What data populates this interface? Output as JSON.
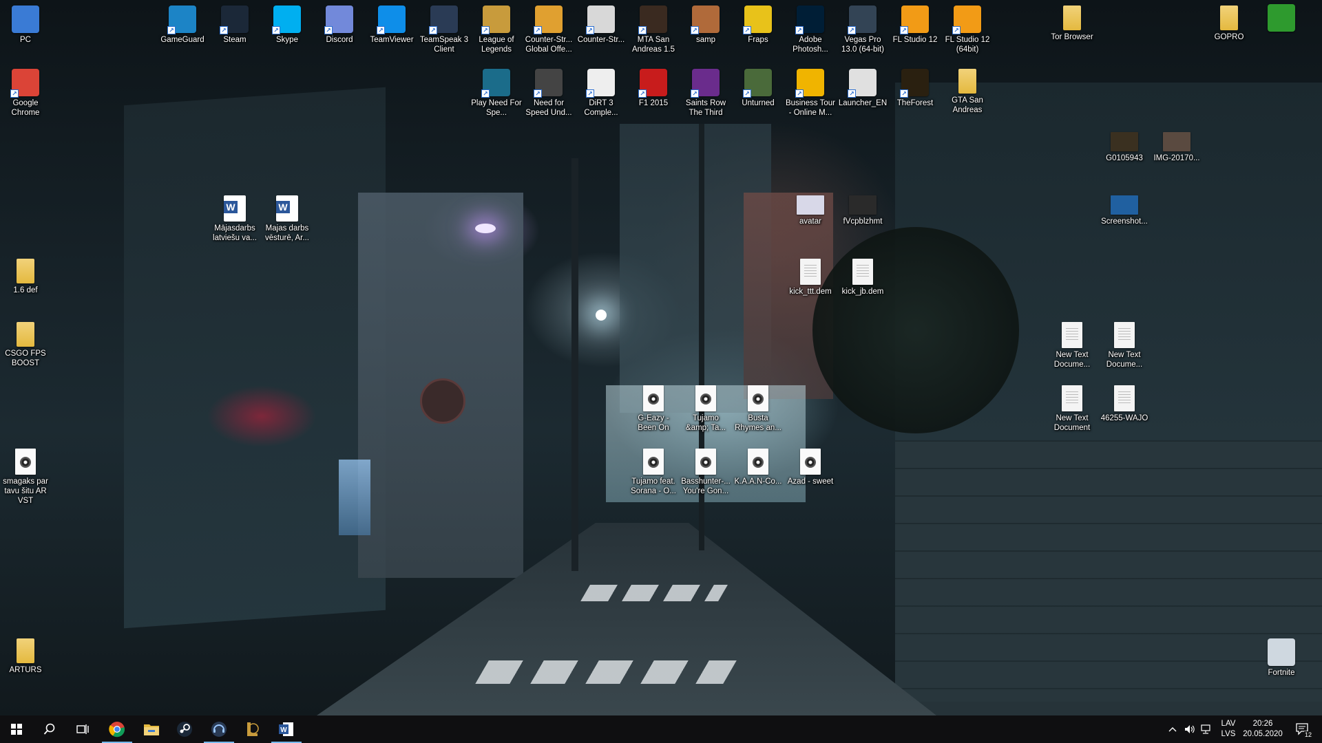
{
  "desktop_icons": [
    {
      "id": "pc",
      "label": "PC",
      "kind": "app",
      "color": "#3a7bd5",
      "glyph": "monitor-icon",
      "shortcut": false
    },
    {
      "id": "chrome",
      "label": "Google Chrome",
      "kind": "app",
      "color": "#db4437",
      "glyph": "chrome-icon",
      "shortcut": true
    },
    {
      "id": "gameguard",
      "label": "GameGuard",
      "kind": "app",
      "color": "#1c84c6",
      "glyph": "gameguard-icon",
      "shortcut": true
    },
    {
      "id": "steam",
      "label": "Steam",
      "kind": "app",
      "color": "#1b2838",
      "glyph": "steam-icon",
      "shortcut": true
    },
    {
      "id": "skype",
      "label": "Skype",
      "kind": "app",
      "color": "#00aff0",
      "glyph": "skype-icon",
      "shortcut": true
    },
    {
      "id": "discord",
      "label": "Discord",
      "kind": "app",
      "color": "#7289da",
      "glyph": "discord-icon",
      "shortcut": true
    },
    {
      "id": "teamviewer",
      "label": "TeamViewer",
      "kind": "app",
      "color": "#0e8ee9",
      "glyph": "teamviewer-icon",
      "shortcut": true
    },
    {
      "id": "teamspeak",
      "label": "TeamSpeak 3 Client",
      "kind": "app",
      "color": "#2a3b55",
      "glyph": "teamspeak-icon",
      "shortcut": true
    },
    {
      "id": "lol",
      "label": "League of Legends",
      "kind": "app",
      "color": "#c89b3c",
      "glyph": "league-icon",
      "shortcut": true
    },
    {
      "id": "csgo",
      "label": "Counter-Str... Global Offe...",
      "kind": "app",
      "color": "#e0a030",
      "glyph": "csgo-icon",
      "shortcut": true
    },
    {
      "id": "cs",
      "label": "Counter-Str...",
      "kind": "app",
      "color": "#d8d8d8",
      "glyph": "counter-strike-icon",
      "shortcut": true
    },
    {
      "id": "mta",
      "label": "MTA San Andreas 1.5",
      "kind": "app",
      "color": "#3a2a20",
      "glyph": "mta-icon",
      "shortcut": true
    },
    {
      "id": "samp",
      "label": "samp",
      "kind": "app",
      "color": "#b06a3a",
      "glyph": "samp-icon",
      "shortcut": true
    },
    {
      "id": "fraps",
      "label": "Fraps",
      "kind": "app",
      "color": "#e8c21a",
      "glyph": "fraps-icon",
      "shortcut": true
    },
    {
      "id": "photoshop",
      "label": "Adobe Photosh...",
      "kind": "app",
      "color": "#001e36",
      "glyph": "photoshop-icon",
      "shortcut": true
    },
    {
      "id": "vegas",
      "label": "Vegas Pro 13.0 (64-bit)",
      "kind": "app",
      "color": "#334455",
      "glyph": "vegas-icon",
      "shortcut": true
    },
    {
      "id": "fl12",
      "label": "FL Studio 12",
      "kind": "app",
      "color": "#f29b16",
      "glyph": "fl-studio-icon",
      "shortcut": true
    },
    {
      "id": "fl12x64",
      "label": "FL Studio 12 (64bit)",
      "kind": "app",
      "color": "#f29b16",
      "glyph": "fl-studio-icon",
      "shortcut": true
    },
    {
      "id": "tor",
      "label": "Tor Browser",
      "kind": "folder",
      "color": "#e4b93f",
      "glyph": "folder-icon",
      "shortcut": false
    },
    {
      "id": "gopro",
      "label": "GOPRO",
      "kind": "folder",
      "color": "#e4b93f",
      "glyph": "folder-icon",
      "shortcut": false
    },
    {
      "id": "tree",
      "label": "",
      "kind": "app",
      "color": "#2e9a2e",
      "glyph": "tree-icon",
      "shortcut": false
    },
    {
      "id": "nfs",
      "label": "Play Need For Spe...",
      "kind": "app",
      "color": "#1b6c8a",
      "glyph": "nfs-icon",
      "shortcut": true
    },
    {
      "id": "nfsu",
      "label": "Need for Speed Und...",
      "kind": "app",
      "color": "#444",
      "glyph": "nfs-icon",
      "shortcut": true
    },
    {
      "id": "dirt3",
      "label": "DiRT 3 Comple...",
      "kind": "app",
      "color": "#eeeeee",
      "glyph": "dirt-icon",
      "shortcut": true
    },
    {
      "id": "f1",
      "label": "F1 2015",
      "kind": "app",
      "color": "#c81c1c",
      "glyph": "f1-icon",
      "shortcut": true
    },
    {
      "id": "saintsrow",
      "label": "Saints Row The Third",
      "kind": "app",
      "color": "#6a2c8c",
      "glyph": "saints-row-icon",
      "shortcut": true
    },
    {
      "id": "unturned",
      "label": "Unturned",
      "kind": "app",
      "color": "#4a6a3a",
      "glyph": "unturned-icon",
      "shortcut": true
    },
    {
      "id": "businesstour",
      "label": "Business Tour - Online M...",
      "kind": "app",
      "color": "#f0b400",
      "glyph": "coin-icon",
      "shortcut": true
    },
    {
      "id": "launcher",
      "label": "Launcher_EN",
      "kind": "app",
      "color": "#e0e0e0",
      "glyph": "java-icon",
      "shortcut": true
    },
    {
      "id": "theforest",
      "label": "TheForest",
      "kind": "app",
      "color": "#2a2010",
      "glyph": "forest-icon",
      "shortcut": true
    },
    {
      "id": "gtasa",
      "label": "GTA San Andreas",
      "kind": "folder",
      "color": "#e4b93f",
      "glyph": "folder-icon",
      "shortcut": false
    },
    {
      "id": "g0105943",
      "label": "G0105943",
      "kind": "photo",
      "color": "#3a3020",
      "glyph": "photo-icon",
      "shortcut": false
    },
    {
      "id": "img2017",
      "label": "IMG-20170...",
      "kind": "photo",
      "color": "#5a4a40",
      "glyph": "photo-icon",
      "shortcut": false
    },
    {
      "id": "majasdarbs1",
      "label": "Mājasdarbs latviešu va...",
      "kind": "word",
      "color": "#2b579a",
      "glyph": "word-icon",
      "shortcut": false
    },
    {
      "id": "majasdarbs2",
      "label": "Majas darbs vēsturē, Ar...",
      "kind": "word",
      "color": "#2b579a",
      "glyph": "word-icon",
      "shortcut": false
    },
    {
      "id": "avatar",
      "label": "avatar",
      "kind": "photo",
      "color": "#d8d8e8",
      "glyph": "photo-icon",
      "shortcut": false
    },
    {
      "id": "fvcp",
      "label": "fVcpblzhmt",
      "kind": "photo",
      "color": "#2a2a2a",
      "glyph": "photo-icon",
      "shortcut": false
    },
    {
      "id": "screenshot",
      "label": "Screenshot...",
      "kind": "photo",
      "color": "#2060a0",
      "glyph": "photo-icon",
      "shortcut": false
    },
    {
      "id": "def16",
      "label": "1.6 def",
      "kind": "folder",
      "color": "#e4b93f",
      "glyph": "folder-icon",
      "shortcut": false
    },
    {
      "id": "kickttt",
      "label": "kick_ttt.dem",
      "kind": "file",
      "color": "#f4f4f4",
      "glyph": "file-icon",
      "shortcut": false
    },
    {
      "id": "kickjb",
      "label": "kick_jb.dem",
      "kind": "file",
      "color": "#f4f4f4",
      "glyph": "file-icon",
      "shortcut": false
    },
    {
      "id": "csgofps",
      "label": "CSGO FPS BOOST",
      "kind": "folder",
      "color": "#e4b93f",
      "glyph": "folder-icon",
      "shortcut": false
    },
    {
      "id": "newtext1",
      "label": "New Text Docume...",
      "kind": "file",
      "color": "#f4f4f4",
      "glyph": "text-file-icon",
      "shortcut": false
    },
    {
      "id": "newtext2",
      "label": "New Text Docume...",
      "kind": "file",
      "color": "#f4f4f4",
      "glyph": "text-file-icon",
      "shortcut": false
    },
    {
      "id": "newtext3",
      "label": "New Text Document",
      "kind": "file",
      "color": "#f4f4f4",
      "glyph": "text-file-icon",
      "shortcut": false
    },
    {
      "id": "wajo",
      "label": "46255-WAJO",
      "kind": "file",
      "color": "#f4f4f4",
      "glyph": "text-file-icon",
      "shortcut": false
    },
    {
      "id": "geazy",
      "label": "G-Eazy - Been On",
      "kind": "audio",
      "color": "#fafafa",
      "glyph": "audio-file-icon",
      "shortcut": false
    },
    {
      "id": "tujamo1",
      "label": "Tujamo &amp; Ta...",
      "kind": "audio",
      "color": "#fafafa",
      "glyph": "audio-file-icon",
      "shortcut": false
    },
    {
      "id": "busta",
      "label": "Busta Rhymes an...",
      "kind": "audio",
      "color": "#fafafa",
      "glyph": "audio-file-icon",
      "shortcut": false
    },
    {
      "id": "smagaks",
      "label": "smagaks par tavu šitu AR VST",
      "kind": "audio",
      "color": "#fafafa",
      "glyph": "audio-file-icon",
      "shortcut": false
    },
    {
      "id": "tujamo2",
      "label": "Tujamo feat. Sorana - O...",
      "kind": "audio",
      "color": "#fafafa",
      "glyph": "audio-file-icon",
      "shortcut": false
    },
    {
      "id": "basshunter",
      "label": "Basshunter-... You're Gon...",
      "kind": "audio",
      "color": "#fafafa",
      "glyph": "audio-file-icon",
      "shortcut": false
    },
    {
      "id": "kaan",
      "label": "K.A.A.N-Co...",
      "kind": "audio",
      "color": "#fafafa",
      "glyph": "audio-file-icon",
      "shortcut": false
    },
    {
      "id": "azad",
      "label": "Azad - sweet",
      "kind": "audio",
      "color": "#fafafa",
      "glyph": "audio-file-icon",
      "shortcut": false
    },
    {
      "id": "arturs",
      "label": "ARTURS",
      "kind": "folder",
      "color": "#e4b93f",
      "glyph": "folder-icon",
      "shortcut": false
    },
    {
      "id": "fortnite",
      "label": "Fortnite",
      "kind": "app",
      "color": "#cfd8e0",
      "glyph": "recycle-bin-icon",
      "shortcut": false
    }
  ],
  "taskbar": {
    "apps": [
      {
        "id": "start",
        "glyph": "windows-start-icon",
        "active": false
      },
      {
        "id": "search",
        "glyph": "search-icon",
        "active": false
      },
      {
        "id": "taskview",
        "glyph": "task-view-icon",
        "active": false
      },
      {
        "id": "chrome",
        "glyph": "chrome-icon",
        "active": true
      },
      {
        "id": "explorer",
        "glyph": "file-explorer-icon",
        "active": false
      },
      {
        "id": "steam",
        "glyph": "steam-icon",
        "active": false
      },
      {
        "id": "teamspeak",
        "glyph": "teamspeak-icon",
        "active": true
      },
      {
        "id": "league",
        "glyph": "league-icon",
        "active": false
      },
      {
        "id": "word",
        "glyph": "word-icon",
        "active": true
      }
    ],
    "tray": {
      "language_top": "LAV",
      "language_bottom": "LVS",
      "time": "20:26",
      "date": "20.05.2020",
      "notifications": "12"
    }
  }
}
